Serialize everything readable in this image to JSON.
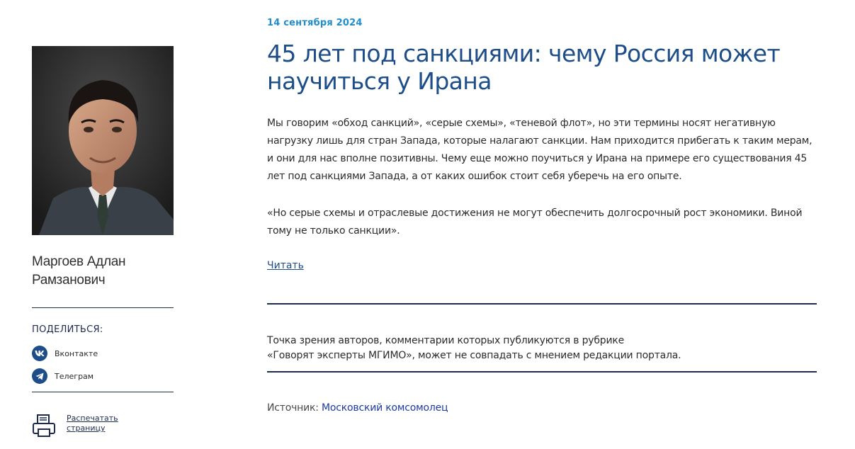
{
  "author": {
    "name_line1": "Маргоев Адлан",
    "name_line2": "Рамзанович"
  },
  "share": {
    "title": "ПОДЕЛИТЬСЯ:",
    "items": [
      {
        "label": "Вконтакте",
        "icon": "vk-icon"
      },
      {
        "label": "Телеграм",
        "icon": "telegram-icon"
      }
    ]
  },
  "print": {
    "label": "Распечатать страницу",
    "icon": "printer-icon"
  },
  "article": {
    "date": "14 сентября 2024",
    "title": "45 лет под санкциями: чему Россия может научиться у Ирана",
    "lead": "Мы говорим «обход санкций», «серые схемы», «теневой флот», но эти термины носят негативную нагрузку лишь для стран Запада, которые налагают санкции. Нам приходится прибегать к таким мерам, и они для нас вполне позитивны. Чему еще можно поучиться у Ирана на примере его существования 45 лет под санкциями Запада, а от каких ошибок стоит себя уберечь на его опыте.",
    "quote": "«Но серые схемы и отраслевые достижения не могут обеспечить долгосрочный рост экономики. Виной тому не только санкции».",
    "read_label": "Читать",
    "disclaimer_line1": "Точка зрения авторов, комментарии которых публикуются в рубрике",
    "disclaimer_line2": "«Говорят эксперты МГИМО», может не совпадать с мнением редакции портала.",
    "source_label": "Источник:",
    "source_link": "Московский комсомолец"
  },
  "colors": {
    "accent_blue": "#1d4e89",
    "date_blue": "#1f8ecd",
    "navy": "#1d2b4f",
    "link_blue": "#1d3aa6"
  }
}
